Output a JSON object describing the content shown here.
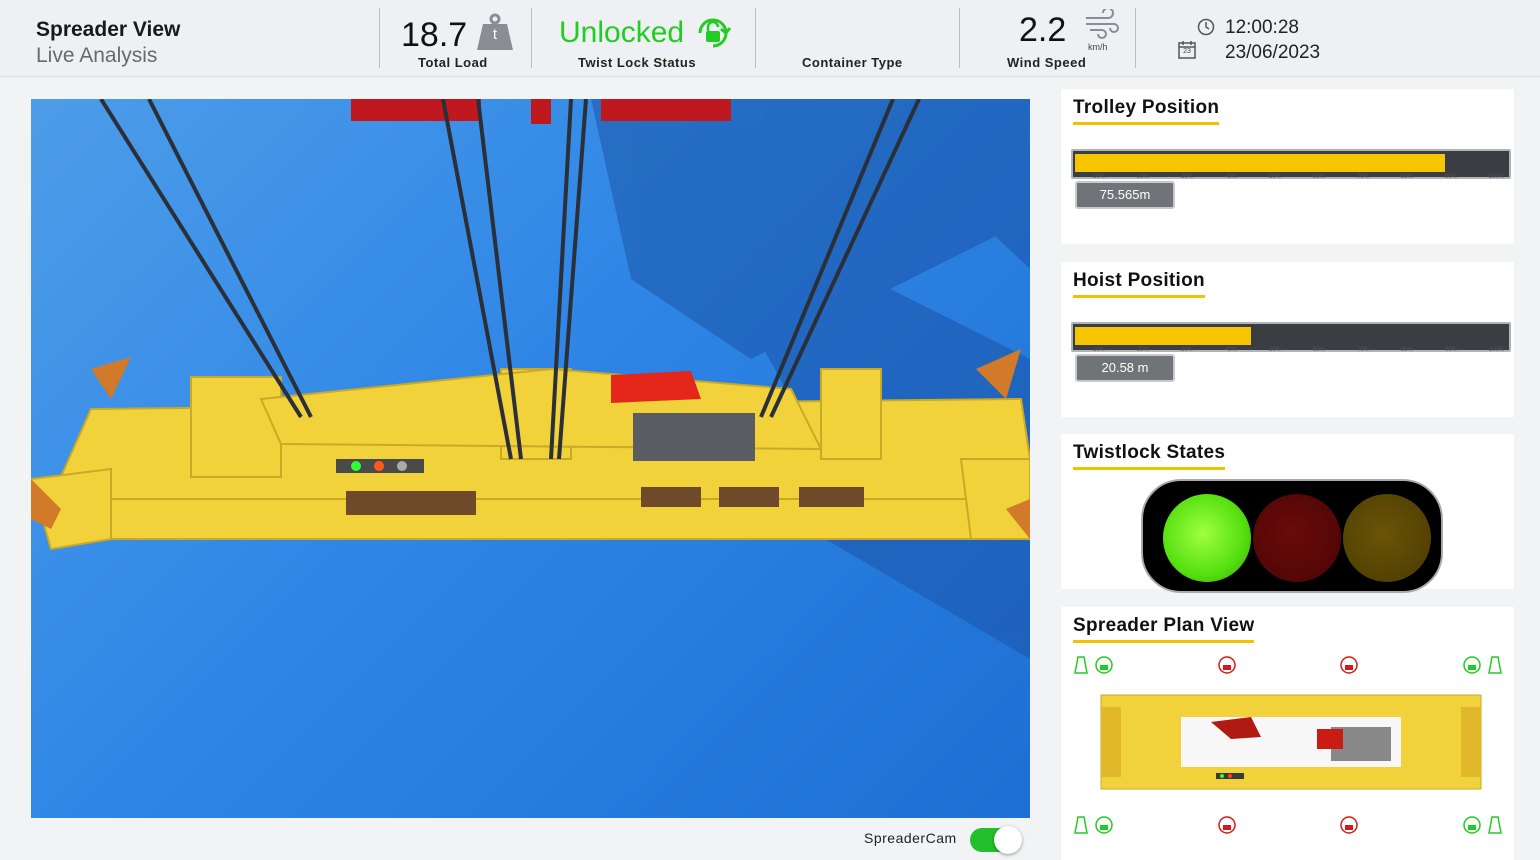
{
  "header": {
    "title": "Spreader View",
    "subtitle": "Live Analysis",
    "total_load": {
      "value": "18.7",
      "unit": "t",
      "caption": "Total Load"
    },
    "twist_lock": {
      "value": "Unlocked",
      "caption": "Twist Lock Status"
    },
    "container_type": {
      "caption": "Container Type"
    },
    "wind_speed": {
      "value": "2.2",
      "unit": "km/h",
      "caption": "Wind Speed"
    },
    "time": "12:00:28",
    "date": "23/06/2023",
    "calendar_day": "23"
  },
  "panels": {
    "trolley": {
      "title": "Trolley Position",
      "readout": "75.565m",
      "fill_fraction": 0.86
    },
    "hoist": {
      "title": "Hoist Position",
      "readout": "20.58 m",
      "fill_fraction": 0.41
    },
    "twistlock_states": {
      "title": "Twistlock States",
      "lights": [
        "green-on",
        "red-off",
        "amber-off"
      ]
    },
    "plan_view": {
      "title": "Spreader Plan View"
    }
  },
  "scale_ticks": [
    "10%",
    "20%",
    "30%",
    "40%",
    "50%",
    "60%",
    "70%",
    "80%",
    "90%",
    "100%"
  ],
  "footer": {
    "camera_label": "SpreaderCam",
    "camera_on": true
  },
  "colors": {
    "accent_yellow": "#f7c500",
    "unlocked_green": "#22cc22",
    "locked_red": "#d11a1a",
    "sky_blue": "#2f86e6"
  }
}
